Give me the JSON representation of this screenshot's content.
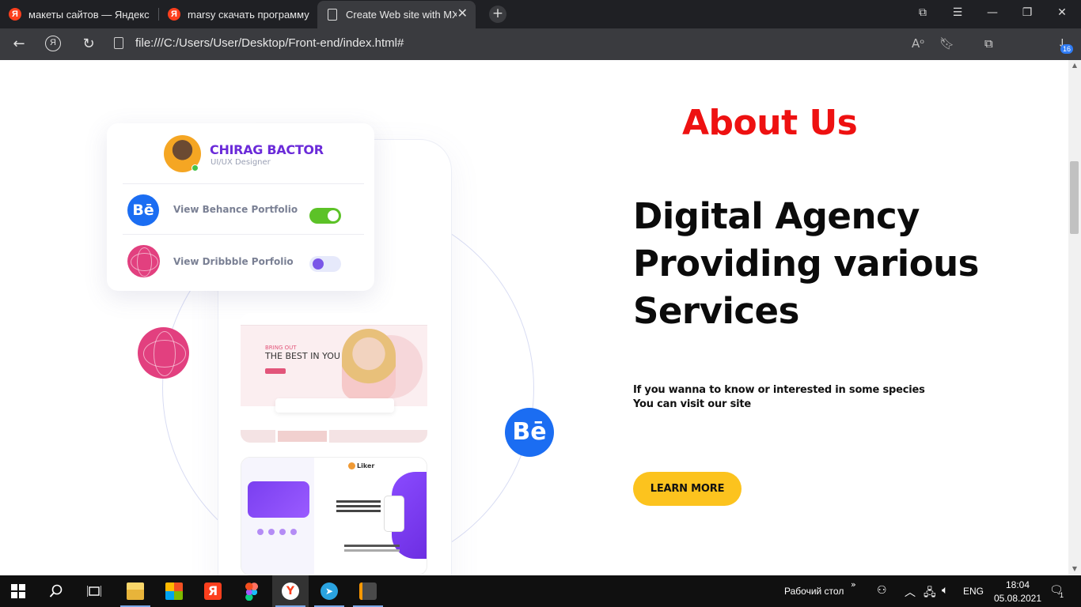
{
  "browser": {
    "tabs": [
      {
        "title": "макеты сайтов — Яндекс",
        "favicon": "yandex-icon"
      },
      {
        "title": "marsy скачать программу",
        "favicon": "yandex-icon"
      },
      {
        "title": "Create Web site with MX",
        "favicon": "document-icon",
        "active": true
      }
    ],
    "new_tab_symbol": "+",
    "url": "file:///C:/Users/User/Desktop/Front-end/index.html#",
    "download_count": "16"
  },
  "page": {
    "about_title": "About Us",
    "headline_line1": "Digital Agency",
    "headline_line2": "Providing various",
    "headline_line3": "Services",
    "desc_line1": "If you wanna to know or interested in some species",
    "desc_line2": "You can visit our site",
    "cta_label": "LEARN MORE",
    "colors": {
      "title": "#ee1111",
      "cta": "#fcc31e",
      "headline": "#0b0b0b"
    }
  },
  "illustration": {
    "profile_name": "CHIRAG BACTOR",
    "profile_role": "UI/UX Designer",
    "behance_label": "View Behance Portfolio",
    "dribbble_label": "View Dribbble Porfolio",
    "behance_toggle_on": true,
    "dribbble_toggle_on": false,
    "behance_glyph": "Bē",
    "screen1_kicker": "BRING OUT",
    "screen1_heading": "THE BEST IN YOU",
    "screen2_brand": "Liker"
  },
  "taskbar": {
    "desktop_label": "Рабочий стол",
    "language": "ENG",
    "time": "18:04",
    "date": "05.08.2021",
    "notification_count": "1",
    "apps": [
      "file-explorer-icon",
      "store-icon",
      "yandex-icon",
      "figma-icon",
      "yandex-browser-icon",
      "telegram-icon",
      "sublime-text-icon"
    ]
  }
}
